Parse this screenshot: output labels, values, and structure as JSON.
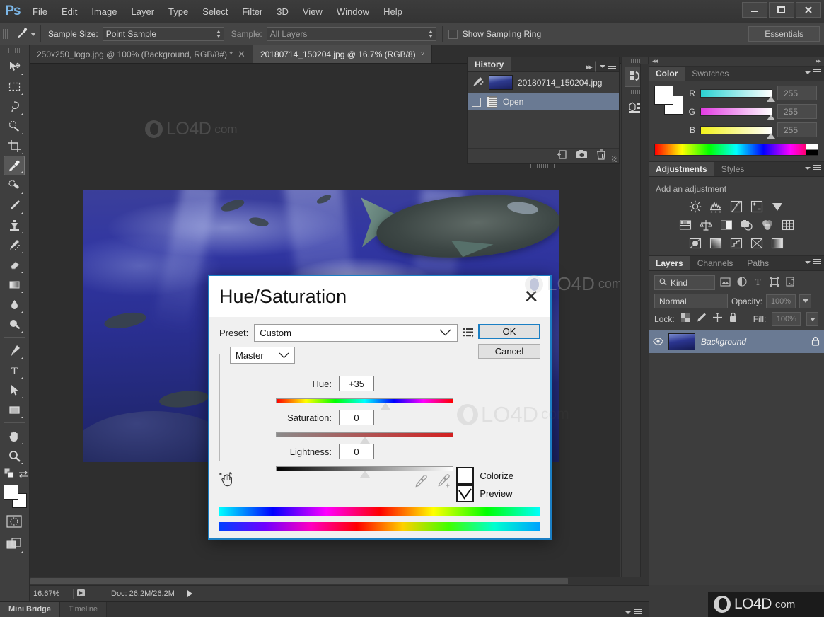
{
  "app": {
    "logo": "Ps",
    "menus": [
      "File",
      "Edit",
      "Image",
      "Layer",
      "Type",
      "Select",
      "Filter",
      "3D",
      "View",
      "Window",
      "Help"
    ],
    "window_buttons": {
      "minimize": "–",
      "maximize": "❐",
      "close": "✕"
    }
  },
  "options_bar": {
    "tool_icon": "eyedropper-icon",
    "sample_size_label": "Sample Size:",
    "sample_size_value": "Point Sample",
    "sample_label": "Sample:",
    "sample_value": "All Layers",
    "show_sampling_ring_label": "Show Sampling Ring",
    "show_sampling_ring_checked": false,
    "workspace": "Essentials"
  },
  "toolbox": {
    "tools": [
      {
        "name": "move-tool",
        "icon": "move-icon"
      },
      {
        "name": "rectangular-marquee-tool",
        "icon": "marquee-icon"
      },
      {
        "name": "lasso-tool",
        "icon": "lasso-icon"
      },
      {
        "name": "quick-selection-tool",
        "icon": "quick-select-icon"
      },
      {
        "name": "crop-tool",
        "icon": "crop-icon"
      },
      {
        "name": "eyedropper-tool",
        "icon": "eyedropper-icon"
      },
      {
        "name": "spot-healing-brush-tool",
        "icon": "healing-icon"
      },
      {
        "name": "brush-tool",
        "icon": "brush-icon"
      },
      {
        "name": "clone-stamp-tool",
        "icon": "stamp-icon"
      },
      {
        "name": "history-brush-tool",
        "icon": "history-brush-icon"
      },
      {
        "name": "eraser-tool",
        "icon": "eraser-icon"
      },
      {
        "name": "gradient-tool",
        "icon": "gradient-icon"
      },
      {
        "name": "blur-tool",
        "icon": "blur-drop-icon"
      },
      {
        "name": "dodge-tool",
        "icon": "dodge-icon"
      },
      {
        "name": "pen-tool",
        "icon": "pen-icon"
      },
      {
        "name": "type-tool",
        "icon": "type-t-icon"
      },
      {
        "name": "path-selection-tool",
        "icon": "arrow-cursor-icon"
      },
      {
        "name": "rectangle-tool",
        "icon": "rectangle-shape-icon"
      },
      {
        "name": "hand-tool",
        "icon": "hand-icon"
      },
      {
        "name": "zoom-tool",
        "icon": "magnifier-icon"
      }
    ],
    "active_tool": "eyedropper-tool",
    "foreground_color": "#ffffff",
    "background_color": "#ffffff",
    "quick_mask": "quick-mask-icon",
    "screen_mode": "screen-mode-icon"
  },
  "document_tabs": [
    {
      "label": "250x250_logo.jpg @ 100% (Background, RGB/8#) *",
      "active": false,
      "closable": true
    },
    {
      "label": "20180714_150204.jpg @ 16.7% (RGB/8)",
      "active": true,
      "closable": false
    }
  ],
  "history_panel": {
    "tab": "History",
    "snapshot": "20180714_150204.jpg",
    "states": [
      {
        "label": "Open",
        "selected": true
      }
    ],
    "footer_icons": [
      "new-document-from-state-icon",
      "create-snapshot-icon",
      "delete-state-icon"
    ]
  },
  "icon_dock": [
    {
      "name": "history-dock-icon",
      "glyph": "history"
    },
    {
      "name": "properties-dock-icon",
      "glyph": "properties"
    }
  ],
  "color_panel": {
    "tabs": [
      "Color",
      "Swatches"
    ],
    "active_tab": "Color",
    "channels": [
      {
        "label": "R",
        "value": "255"
      },
      {
        "label": "G",
        "value": "255"
      },
      {
        "label": "B",
        "value": "255"
      }
    ]
  },
  "adjustments_panel": {
    "tabs": [
      "Adjustments",
      "Styles"
    ],
    "active_tab": "Adjustments",
    "heading": "Add an adjustment",
    "icons": [
      [
        "brightness-contrast-icon",
        "levels-icon",
        "curves-icon",
        "exposure-icon",
        "vibrance-icon"
      ],
      [
        "hue-saturation-icon",
        "color-balance-icon",
        "black-white-icon",
        "photo-filter-icon",
        "channel-mixer-icon",
        "color-lookup-icon"
      ],
      [
        "invert-icon",
        "posterize-icon",
        "threshold-icon",
        "selective-color-icon",
        "gradient-map-icon"
      ]
    ]
  },
  "layers_panel": {
    "tabs": [
      "Layers",
      "Channels",
      "Paths"
    ],
    "active_tab": "Layers",
    "filter_kind": "Kind",
    "filter_icons": [
      "filter-image-icon",
      "filter-adjustment-icon",
      "filter-type-icon",
      "filter-shape-icon",
      "filter-smart-object-icon"
    ],
    "blend_mode": "Normal",
    "opacity_label": "Opacity:",
    "opacity_value": "100%",
    "lock_label": "Lock:",
    "lock_icons": [
      "lock-transparency-icon",
      "lock-image-icon",
      "lock-position-icon",
      "lock-all-icon"
    ],
    "fill_label": "Fill:",
    "fill_value": "100%",
    "layers": [
      {
        "name": "Background",
        "visible": true,
        "locked": true,
        "selected": true
      }
    ],
    "footer_icons": [
      "link-layers-icon",
      "layer-style-fx-icon",
      "add-mask-icon",
      "new-group-icon"
    ]
  },
  "dialog": {
    "title": "Hue/Saturation",
    "close_glyph": "✕",
    "preset_label": "Preset:",
    "preset_value": "Custom",
    "preset_menu_icon": "preset-options-icon",
    "ok_label": "OK",
    "cancel_label": "Cancel",
    "channel_value": "Master",
    "sliders": [
      {
        "label": "Hue:",
        "value": "+35",
        "position_pct": 62
      },
      {
        "label": "Saturation:",
        "value": "0",
        "position_pct": 50
      },
      {
        "label": "Lightness:",
        "value": "0",
        "position_pct": 50
      }
    ],
    "targeted_adjustment_icon": "targeted-adjustment-hand-icon",
    "eyedropper_icons": [
      "eyedropper-icon",
      "eyedropper-add-icon",
      "eyedropper-subtract-icon"
    ],
    "colorize_label": "Colorize",
    "colorize_checked": false,
    "preview_label": "Preview",
    "preview_checked": true
  },
  "status_bar": {
    "zoom": "16.67%",
    "doc_info": "Doc: 26.2M/26.2M",
    "bottom_tabs": [
      {
        "label": "Mini Bridge",
        "active": true
      },
      {
        "label": "Timeline",
        "active": false
      }
    ]
  },
  "watermarks": {
    "brand": "LO4D",
    "suffix": "com"
  }
}
